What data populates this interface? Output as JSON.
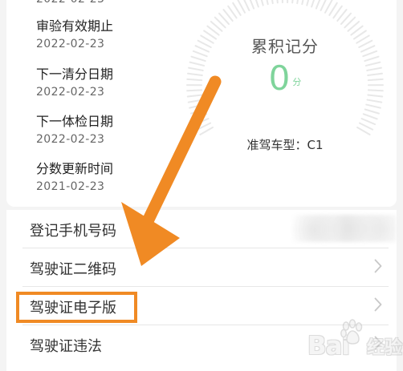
{
  "header": {
    "partial_date": "2022-02-23"
  },
  "details": [
    {
      "label": "审验有效期止",
      "value": "2022-02-23"
    },
    {
      "label": "下一清分日期",
      "value": "2022-02-23"
    },
    {
      "label": "下一体检日期",
      "value": "2022-02-23"
    },
    {
      "label": "分数更新时间",
      "value": "2021-02-23"
    }
  ],
  "gauge": {
    "title": "累积记分",
    "score": "0",
    "unit": "分",
    "license_text": "准驾车型：C1",
    "score_color": "#7fd49b",
    "tick_color": "#e8e8e8"
  },
  "list": [
    {
      "label": "登记手机号码"
    },
    {
      "label": "驾驶证二维码"
    },
    {
      "label": "驾驶证电子版"
    },
    {
      "label": "驾驶证违法"
    }
  ],
  "annotations": {
    "highlight_color": "#f08a24",
    "arrow_color": "#f08a24"
  },
  "watermark": {
    "text": "Bai",
    "subtext": "经验"
  },
  "icons": {
    "chevron": "chevron-right-icon",
    "paw": "paw-icon"
  }
}
